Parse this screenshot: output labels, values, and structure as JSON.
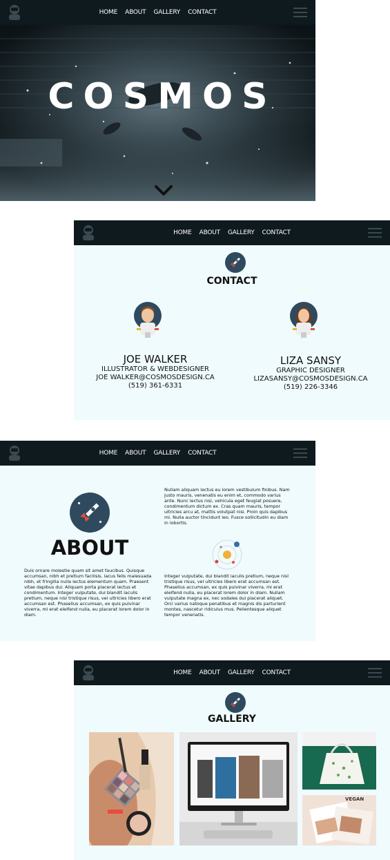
{
  "nav": {
    "links": [
      "HOME",
      "ABOUT",
      "GALLERY",
      "CONTACT"
    ]
  },
  "hero": {
    "title": "COSMOS"
  },
  "contact": {
    "title": "CONTACT",
    "people": [
      {
        "name": "JOE WALKER",
        "role": "ILLUSTRATOR & WEBDESIGNER",
        "email": "JOE WALKER@COSMOSDESIGN.CA",
        "phone": "(519) 361-6331"
      },
      {
        "name": "LIZA SANSY",
        "role": "GRAPHIC DESIGNER",
        "email": "LIZASANSY@COSMOSDESIGN.CA",
        "phone": "(519) 226-3346"
      }
    ]
  },
  "about": {
    "title": "ABOUT",
    "text_left": "Duis ornare molestie quam sit amet faucibus. Quisque accumsan, nibh et pretium facilisis, lacus felis malesuada nibh, et fringilla nulla lectus elementum quam. Praesent vitae dapibus dui. Aliquam porta placerat lectus et condimentum. Integer vulputate, dui blandit iaculis pretium, neque nisl tristique risus, vel ultricies libero erat accumsan est. Phasellus accumsan, ex quis pulvinar viverra, mi erat eleifend nulla, eu placerat lorem dolor in diam.",
    "text_right_top": "Nullam aliquam lectus eu lorem vestibulum finibus. Nam justo mauris, venenatis eu enim et, commodo varius ante. Nunc lectus nisi, vehicula eget feugiat posuere, condimentum dictum ex. Cras quam mauris, tempor ultricies arcu at, mattis volutpat nisi. Proin quis dapibus mi. Nulla auctor tincidunt leo. Fusce sollicitudin eu diam in lobortis.",
    "text_right_bottom": "Integer vulputate, dui blandit iaculis pretium, neque nisl tristique risus, vel ultricies libero erat accumsan est. Phasellus accumsan, ex quis pulvinar viverra, mi erat eleifend nulla, eu placerat lorem dolor in diam. Nullam vulputate magna ex, nec sodales dui placerat aliquet. Orci varius natoque penatibus et magnis dis parturient montes, nascetur ridiculus mus. Pellentesque aliquet tempor venenatis."
  },
  "gallery": {
    "title": "GALLERY",
    "photo_text": "VEGAN"
  },
  "icons": {
    "logo": "astronaut-icon",
    "menu": "hamburger-menu-icon",
    "scroll": "chevron-down-icon",
    "section": "rocket-icon",
    "solar": "solar-system-icon"
  },
  "colors": {
    "navbar": "#0f1a1e",
    "section_bg": "#f0fbfd",
    "icon_circle": "#2f4a5e",
    "rocket_accent": "#e84c3d"
  }
}
